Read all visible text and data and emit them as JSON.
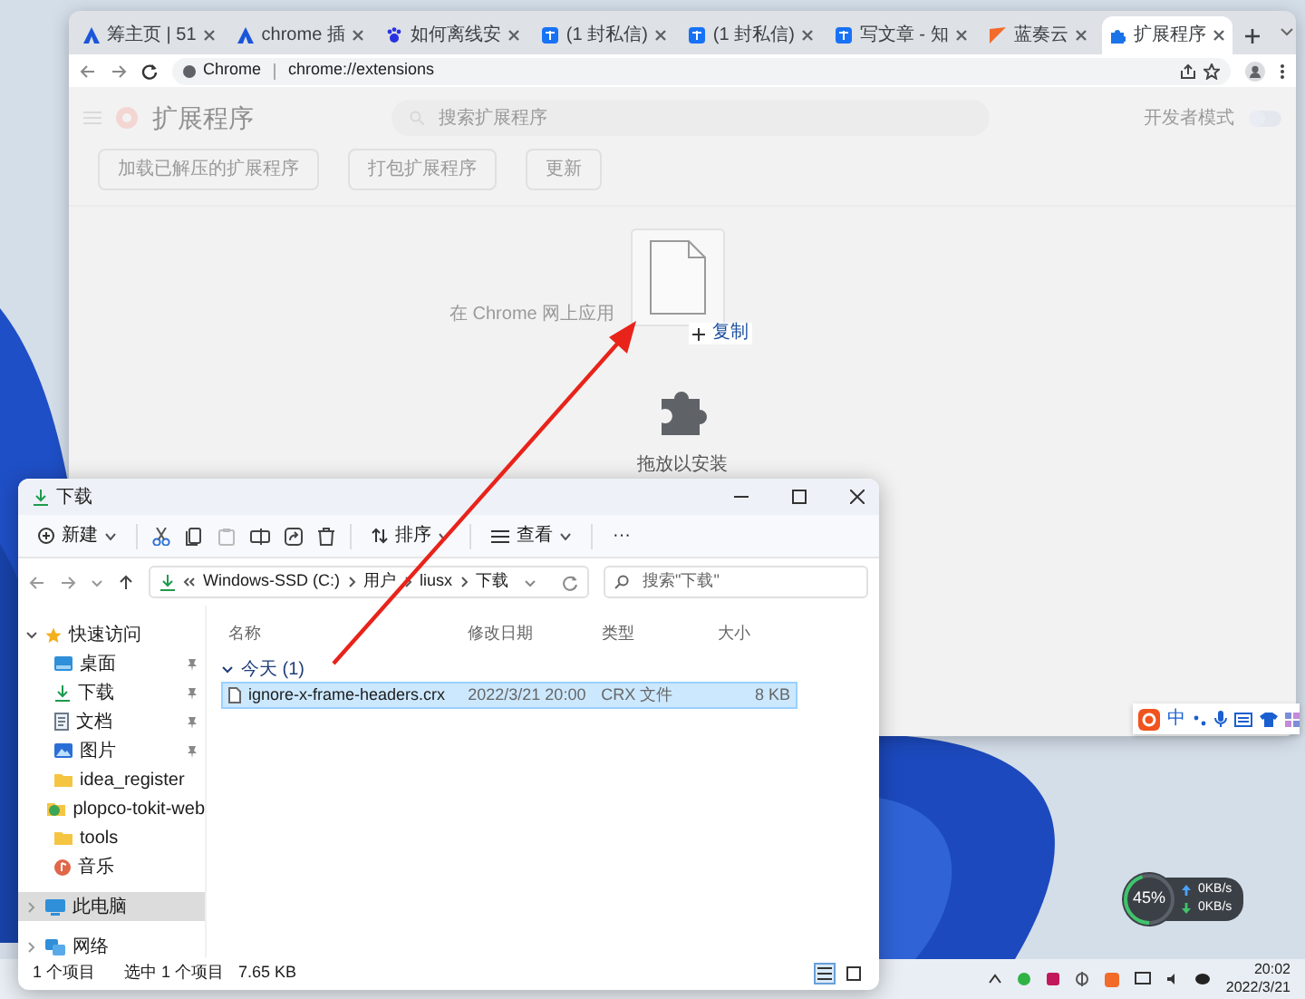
{
  "chrome": {
    "tabs": [
      {
        "label": "筹主页 | 51",
        "kind": "app",
        "selected": false
      },
      {
        "label": "chrome 插",
        "kind": "app",
        "selected": false
      },
      {
        "label": "如何离线安",
        "kind": "paw",
        "selected": false
      },
      {
        "label": "(1 封私信)",
        "kind": "zhihu",
        "selected": false
      },
      {
        "label": "(1 封私信)",
        "kind": "zhihu",
        "selected": false
      },
      {
        "label": "写文章 - 知",
        "kind": "zhihu",
        "selected": false
      },
      {
        "label": "蓝奏云",
        "kind": "flag",
        "selected": false
      },
      {
        "label": "扩展程序",
        "kind": "puzzle",
        "selected": true
      }
    ],
    "address": {
      "site": "Chrome",
      "url": "chrome://extensions"
    },
    "page": {
      "title": "扩展程序",
      "search_placeholder": "搜索扩展程序",
      "developer_mode": {
        "label": "开发者模式",
        "on": false
      },
      "buttons": [
        "加载已解压的扩展程序",
        "打包扩展程序",
        "更新"
      ],
      "notice": "在 Chrome 网上应用",
      "drag": {
        "badge": "复制",
        "drop_label": "拖放以安装"
      }
    }
  },
  "ime": {
    "label": "中"
  },
  "explorer": {
    "title": "下载",
    "toolbar": {
      "new": "新建",
      "sort": "排序",
      "view": "查看",
      "more": "···"
    },
    "path": [
      "Windows-SSD (C:)",
      "用户",
      "liusx",
      "下载"
    ],
    "search_placeholder": "搜索\"下载\"",
    "columns": [
      "名称",
      "修改日期",
      "类型",
      "大小"
    ],
    "group": {
      "label": "今天 (1)",
      "expanded": true
    },
    "rows": [
      {
        "name": "ignore-x-frame-headers.crx",
        "modified": "2022/3/21 20:00",
        "type": "CRX 文件",
        "size": "8 KB",
        "selected": true
      }
    ],
    "sidebar": [
      {
        "label": "快速访问",
        "kind": "star",
        "expanded": true,
        "selected": false,
        "children": [
          {
            "label": "桌面",
            "kind": "desktop",
            "pinned": true,
            "selected": false
          },
          {
            "label": "下载",
            "kind": "download",
            "pinned": true,
            "selected": false
          },
          {
            "label": "文档",
            "kind": "document",
            "pinned": true,
            "selected": false
          },
          {
            "label": "图片",
            "kind": "picture",
            "pinned": true,
            "selected": false
          },
          {
            "label": "idea_register",
            "kind": "folder",
            "pinned": false,
            "selected": false
          },
          {
            "label": "plopco-tokit-web",
            "kind": "project",
            "pinned": false,
            "selected": false
          },
          {
            "label": "tools",
            "kind": "folder",
            "pinned": false,
            "selected": false
          },
          {
            "label": "音乐",
            "kind": "music",
            "pinned": false,
            "selected": false
          }
        ]
      },
      {
        "label": "此电脑",
        "kind": "pc",
        "expanded": false,
        "selected": true
      },
      {
        "label": "网络",
        "kind": "network",
        "expanded": false,
        "selected": false
      }
    ],
    "status": {
      "count": "1 个项目",
      "selection": "选中 1 个项目",
      "size": "7.65 KB"
    },
    "views": [
      {
        "kind": "details",
        "selected": true
      },
      {
        "kind": "tiles",
        "selected": false
      }
    ]
  },
  "widget": {
    "percent": "45%",
    "level": 0.45,
    "upload": "0KB/s",
    "download": "0KB/s"
  },
  "taskbar": {
    "time": "20:02",
    "date": "2022/3/21"
  }
}
